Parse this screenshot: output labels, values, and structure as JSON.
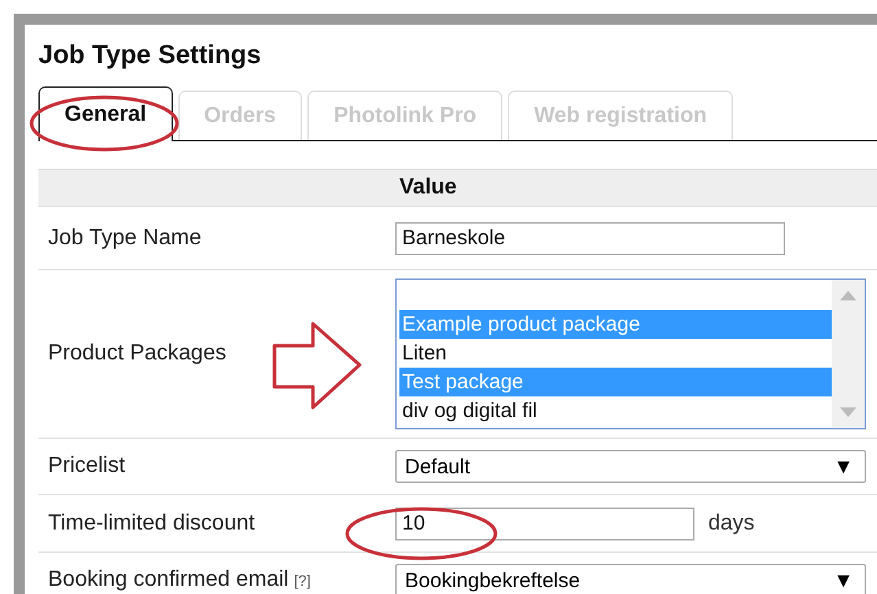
{
  "window": {
    "title": "Job Type Settings"
  },
  "tabs": [
    {
      "label": "General",
      "selected": true
    },
    {
      "label": "Orders",
      "selected": false
    },
    {
      "label": "Photolink Pro",
      "selected": false
    },
    {
      "label": "Web registration",
      "selected": false
    }
  ],
  "table": {
    "columns": [
      "Value"
    ],
    "rows": [
      {
        "kind": "text",
        "label": "Job Type Name",
        "value": "Barneskole"
      },
      {
        "kind": "listbox",
        "label": "Product Packages",
        "options": [
          {
            "label": "Example product package",
            "selected": true
          },
          {
            "label": "Liten",
            "selected": false
          },
          {
            "label": "Test package",
            "selected": true
          },
          {
            "label": "div og digital fil",
            "selected": false
          }
        ]
      },
      {
        "kind": "select",
        "label": "Pricelist",
        "value": "Default",
        "caret": "▼"
      },
      {
        "kind": "number",
        "label": "Time-limited discount",
        "value": "10",
        "unit": "days"
      },
      {
        "kind": "select",
        "label": "Booking confirmed email",
        "help": "[?]",
        "value": "Bookingbekreftelse",
        "caret": "▼"
      }
    ]
  }
}
